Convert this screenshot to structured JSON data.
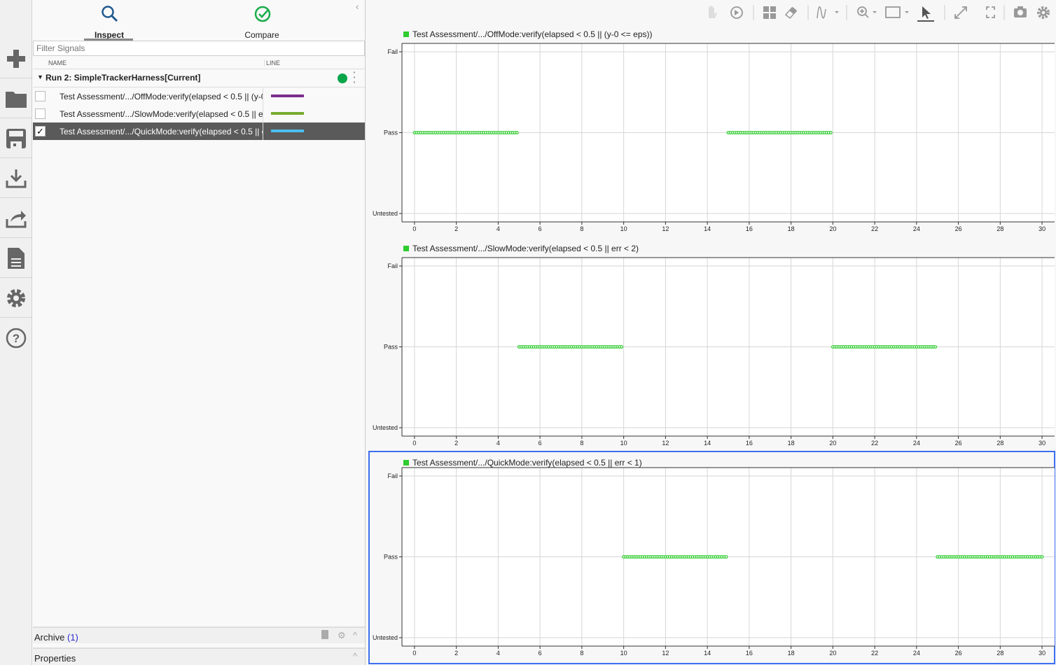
{
  "rail": {
    "items": [
      "add-icon",
      "folder-icon",
      "save-icon",
      "download-icon",
      "share-icon",
      "report-icon",
      "gear-icon",
      "help-icon"
    ]
  },
  "tabs": [
    {
      "label": "Inspect"
    },
    {
      "label": "Compare"
    }
  ],
  "filter": {
    "placeholder": "Filter Signals"
  },
  "table": {
    "col_name": "NAME",
    "col_line": "LINE"
  },
  "run": {
    "label": "Run 2: SimpleTrackerHarness[Current]",
    "status_color": "#0aa64a"
  },
  "signals": [
    {
      "name": "Test Assessment/.../OffMode:verify(elapsed < 0.5 || (y-0 <= eps))",
      "checked": false,
      "color": "#7b2d8e"
    },
    {
      "name": "Test Assessment/.../SlowMode:verify(elapsed < 0.5 || err < 2)",
      "checked": false,
      "color": "#77ac30"
    },
    {
      "name": "Test Assessment/.../QuickMode:verify(elapsed < 0.5 || err < 1)",
      "checked": true,
      "color": "#4dbeee"
    }
  ],
  "archive": {
    "label": "Archive",
    "count": "(1)"
  },
  "properties": {
    "label": "Properties"
  },
  "toolbar": [
    "pan-icon",
    "replay-icon",
    "layout-icon",
    "eraser-icon",
    "signal-icon",
    "zoom-icon",
    "fit-icon",
    "cursor-icon",
    "expand-icon",
    "fullscreen-icon",
    "camera-icon",
    "settings-icon"
  ],
  "chart_data": [
    {
      "type": "scatter",
      "title": "Test Assessment/.../OffMode:verify(elapsed < 0.5 || (y-0 <= eps))",
      "y_categories": [
        "Untested",
        "Pass",
        "Fail"
      ],
      "xlim": [
        -0.6,
        30.6
      ],
      "x_ticks": [
        0,
        2,
        4,
        6,
        8,
        10,
        12,
        14,
        16,
        18,
        20,
        22,
        24,
        26,
        28,
        30
      ],
      "grid": true,
      "color": "#2ecc2e",
      "sample_step": 0.1,
      "pass_intervals": [
        [
          0,
          4.9
        ],
        [
          15,
          19.9
        ]
      ]
    },
    {
      "type": "scatter",
      "title": "Test Assessment/.../SlowMode:verify(elapsed < 0.5 || err < 2)",
      "y_categories": [
        "Untested",
        "Pass",
        "Fail"
      ],
      "xlim": [
        -0.6,
        30.6
      ],
      "x_ticks": [
        0,
        2,
        4,
        6,
        8,
        10,
        12,
        14,
        16,
        18,
        20,
        22,
        24,
        26,
        28,
        30
      ],
      "grid": true,
      "color": "#2ecc2e",
      "sample_step": 0.1,
      "pass_intervals": [
        [
          5,
          9.9
        ],
        [
          20,
          24.9
        ]
      ]
    },
    {
      "type": "scatter",
      "title": "Test Assessment/.../QuickMode:verify(elapsed < 0.5 || err < 1)",
      "y_categories": [
        "Untested",
        "Pass",
        "Fail"
      ],
      "xlim": [
        -0.6,
        30.6
      ],
      "x_ticks": [
        0,
        2,
        4,
        6,
        8,
        10,
        12,
        14,
        16,
        18,
        20,
        22,
        24,
        26,
        28,
        30
      ],
      "grid": true,
      "color": "#2ecc2e",
      "sample_step": 0.1,
      "pass_intervals": [
        [
          10,
          14.9
        ],
        [
          25,
          30
        ]
      ],
      "selected": true
    }
  ]
}
